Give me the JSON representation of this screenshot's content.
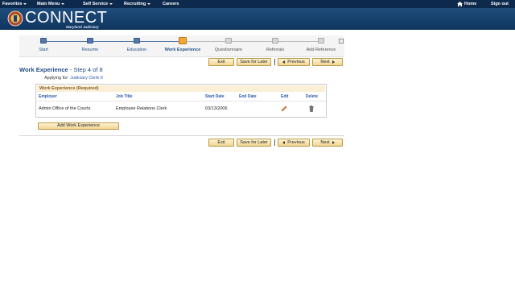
{
  "top_menu": {
    "items": [
      {
        "label": "Favorites",
        "has_dropdown": true
      },
      {
        "label": "Main Menu",
        "has_dropdown": true
      },
      {
        "label": "Self Service",
        "has_dropdown": true
      },
      {
        "label": "Recruiting",
        "has_dropdown": true
      },
      {
        "label": "Careers",
        "has_dropdown": false
      }
    ],
    "home_label": "Home",
    "signout_label": "Sign out"
  },
  "logo": {
    "title": "CONNECT",
    "subtitle": "Maryland Judiciary"
  },
  "progress": {
    "steps": [
      {
        "label": "Start",
        "state": "done"
      },
      {
        "label": "Resume",
        "state": "done"
      },
      {
        "label": "Education",
        "state": "done"
      },
      {
        "label": "Work Experience",
        "state": "current"
      },
      {
        "label": "Questionnaire",
        "state": "todo"
      },
      {
        "label": "Referrals",
        "state": "todo"
      },
      {
        "label": "Add Reference",
        "state": "todo"
      }
    ]
  },
  "nav": {
    "exit": "Exit",
    "save_for_later": "Save for Later",
    "previous": "Previous",
    "next": "Next"
  },
  "page": {
    "title": "Work Experience",
    "step_text": "- Step 4 of 8",
    "applying_label": "Applying for:",
    "applying_job": "Judiciary Clerk II"
  },
  "grid": {
    "title": "Work Experience (Required)",
    "columns": [
      "Employer",
      "Job Title",
      "Start Date",
      "End Date",
      "Edit",
      "Delete"
    ],
    "rows": [
      {
        "employer": "Admin Office of the Courts",
        "job_title": "Employee Relations Clerk",
        "start_date": "03/13/2006",
        "end_date": ""
      }
    ],
    "add_button": "Add Work Experience"
  },
  "colors": {
    "header_dark": "#0d2a4d",
    "brand_blue": "#1f4b84",
    "step_done": "#5578a8",
    "step_current": "#f0a830",
    "step_todo": "#c8c8c8",
    "button_fill": "#f1d592"
  },
  "icons": [
    "caret-down-icon",
    "home-icon",
    "seal-icon",
    "edit-pencil-icon",
    "trash-icon",
    "arrow-left-icon",
    "arrow-right-icon"
  ]
}
